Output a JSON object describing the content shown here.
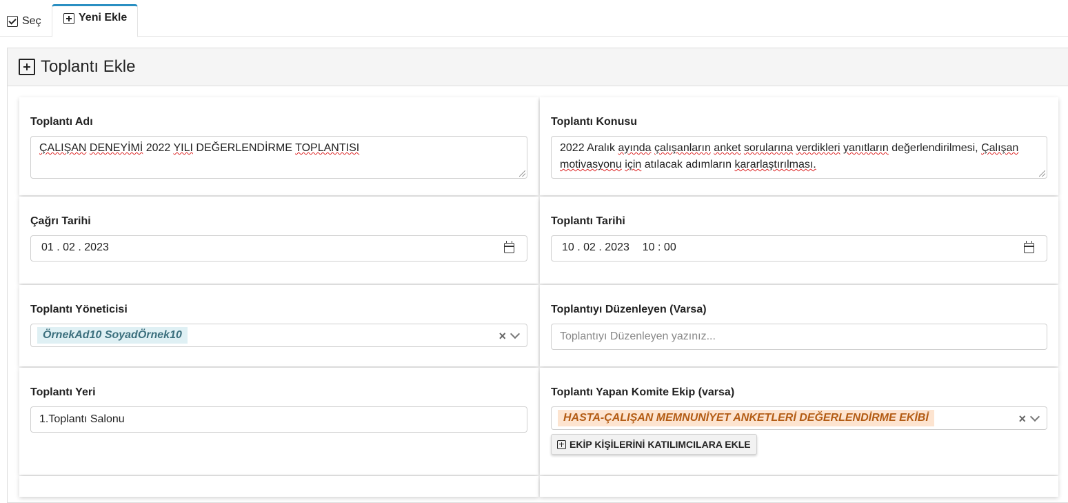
{
  "tabs": [
    {
      "label": "Seç",
      "active": false
    },
    {
      "label": "Yeni Ekle",
      "active": true
    }
  ],
  "panel": {
    "title": "Toplantı Ekle"
  },
  "form": {
    "meeting_name": {
      "label": "Toplantı Adı",
      "value_words": [
        "ÇALIŞAN",
        "DENEYİMİ",
        "2022",
        "YILI",
        "DEĞERLENDİRME",
        "TOPLANTISI"
      ]
    },
    "meeting_subject": {
      "label": "Toplantı Konusu",
      "line1_words": [
        "2022",
        "Aralık",
        "ayında",
        "çalışanların",
        "anket",
        "sorularına",
        "verdikleri",
        "yanıtların",
        "değerlendirilmesi,",
        "Çalışan"
      ],
      "line2_words": [
        "motivasyonu",
        "için",
        "atılacak",
        "adımların",
        "kararlaştırılması."
      ]
    },
    "call_date": {
      "label": "Çağrı Tarihi",
      "day": "01",
      "month": "02",
      "year": "2023"
    },
    "meeting_date": {
      "label": "Toplantı Tarihi",
      "day": "10",
      "month": "02",
      "year": "2023",
      "hour": "10",
      "minute": "00"
    },
    "meeting_manager": {
      "label": "Toplantı Yöneticisi",
      "value": "ÖrnekAd10 SoyadÖrnek10"
    },
    "organizer": {
      "label": "Toplantıyı Düzenleyen (Varsa)",
      "placeholder": "Toplantıyı Düzenleyen yazınız..."
    },
    "location": {
      "label": "Toplantı Yeri",
      "value": "1.Toplantı Salonu"
    },
    "committee": {
      "label": "Toplantı Yapan Komite Ekip (varsa)",
      "value": "HASTA-ÇALIŞAN MEMNUNİYET ANKETLERİ DEĞERLENDİRME EKİBİ",
      "button_label": "EKİP KİŞİLERİNİ KATILIMCILARA EKLE"
    }
  },
  "icons": {
    "select_tab": "checkbox-icon",
    "new_tab": "plus-square-icon",
    "calendar": "calendar-icon",
    "clear": "close-icon",
    "dropdown": "chevron-down-icon"
  },
  "colors": {
    "tab_accent": "#2a8fc2",
    "tag_blue_bg": "#dff0f4",
    "tag_blue_text": "#3b6f7d",
    "tag_orange_bg": "#fde4d0",
    "tag_orange_text": "#b35c14",
    "spellcheck": "#dd2222"
  }
}
